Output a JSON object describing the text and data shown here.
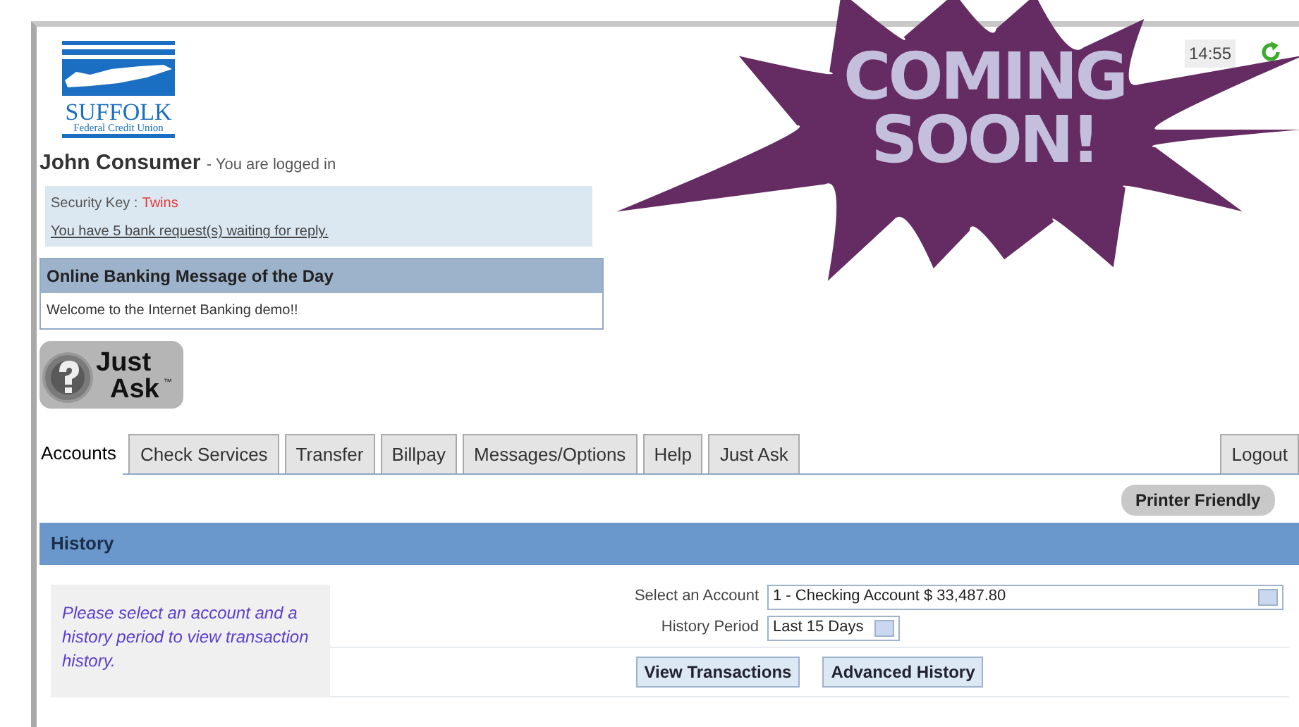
{
  "logo": {
    "name": "SUFFOLK",
    "subtitle": "Federal Credit Union"
  },
  "user": {
    "name": "John Consumer",
    "status": "- You are logged in"
  },
  "security": {
    "label": "Security Key :",
    "key": "Twins",
    "requests_link": "You have 5 bank request(s) waiting for reply."
  },
  "message_of_day": {
    "title": "Online Banking Message of the Day",
    "body": "Welcome to the Internet Banking demo!!"
  },
  "just_ask_logo": {
    "line_1": "Just",
    "line_2": "Ask",
    "mark": "™"
  },
  "tabs": [
    {
      "label": "Accounts",
      "selected": true
    },
    {
      "label": "Check Services",
      "selected": false
    },
    {
      "label": "Transfer",
      "selected": false
    },
    {
      "label": "Billpay",
      "selected": false
    },
    {
      "label": "Messages/Options",
      "selected": false
    },
    {
      "label": "Help",
      "selected": false
    },
    {
      "label": "Just Ask",
      "selected": false
    }
  ],
  "logout": "Logout",
  "printer_friendly": "Printer Friendly",
  "section_title": "History",
  "hint": "Please select an account and a history period to view transaction history.",
  "form": [
    {
      "label": "Select an Account",
      "value": "1 - Checking Account $ 33,487.80",
      "kind": "wide"
    },
    {
      "label": "History Period",
      "value": "Last 15 Days",
      "kind": "narrow"
    }
  ],
  "buttons": [
    "View Transactions",
    "Advanced History"
  ],
  "clock": "14:55",
  "banner": {
    "line_1": "COMING",
    "line_2": "SOON!"
  }
}
